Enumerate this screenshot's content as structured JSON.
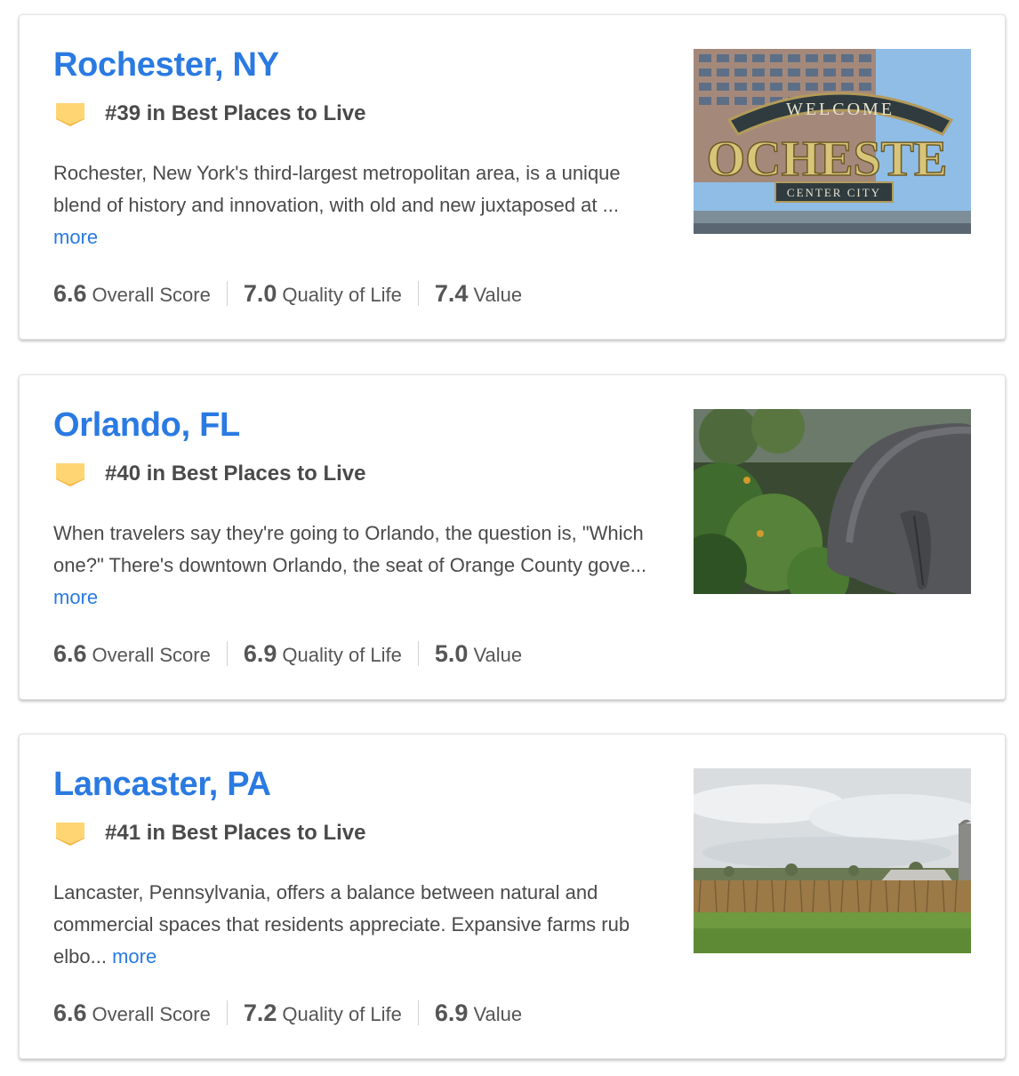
{
  "listings": [
    {
      "city": "Rochester, NY",
      "rank": "#39 in Best Places to Live",
      "description": "Rochester, New York's third-largest metropolitan area, is a unique blend of history and innovation, with old and new juxtaposed at ...",
      "more": "more",
      "scores": [
        {
          "value": "6.6",
          "label": "Overall Score"
        },
        {
          "value": "7.0",
          "label": "Quality of Life"
        },
        {
          "value": "7.4",
          "label": "Value"
        }
      ],
      "image": {
        "sign_top": "WELCOME",
        "sign_main": "OCHESTE",
        "sign_bottom": "CENTER CITY"
      }
    },
    {
      "city": "Orlando, FL",
      "rank": "#40 in Best Places to Live",
      "description": "When travelers say they're going to Orlando, the question is, \"Which one?\" There's downtown Orlando, the seat of Orange County gove...",
      "more": "more",
      "scores": [
        {
          "value": "6.6",
          "label": "Overall Score"
        },
        {
          "value": "6.9",
          "label": "Quality of Life"
        },
        {
          "value": "5.0",
          "label": "Value"
        }
      ]
    },
    {
      "city": "Lancaster, PA",
      "rank": "#41 in Best Places to Live",
      "description": "Lancaster, Pennsylvania, offers a balance between natural and commercial spaces that residents appreciate. Expansive farms rub elbo...",
      "more": "more",
      "scores": [
        {
          "value": "6.6",
          "label": "Overall Score"
        },
        {
          "value": "7.2",
          "label": "Quality of Life"
        },
        {
          "value": "6.9",
          "label": "Value"
        }
      ]
    }
  ],
  "colors": {
    "link": "#2a7ae2",
    "badge": "#f6c25a",
    "text": "#4a4a4a"
  }
}
